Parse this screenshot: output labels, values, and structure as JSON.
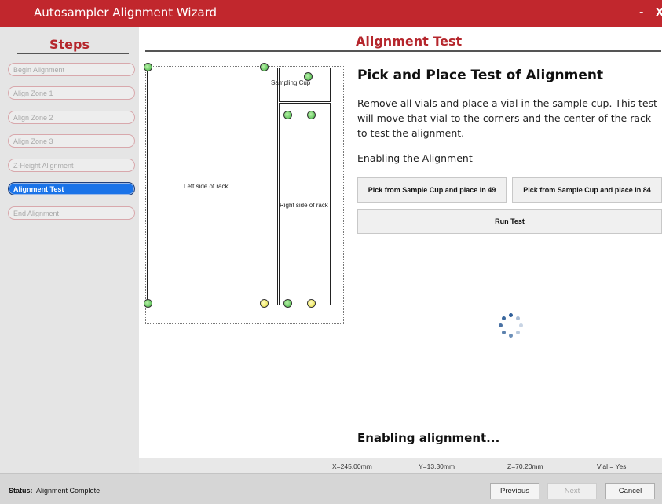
{
  "window": {
    "title": "Autosampler Alignment Wizard",
    "minimize": "-",
    "close": "X"
  },
  "sidebar": {
    "header": "Steps",
    "items": [
      {
        "label": "Begin Alignment"
      },
      {
        "label": "Align Zone 1"
      },
      {
        "label": "Align Zone 2"
      },
      {
        "label": "Align Zone 3"
      },
      {
        "label": "Z-Height Alignment"
      },
      {
        "label": "Alignment Test"
      },
      {
        "label": "End Alignment"
      }
    ],
    "active_index": 5
  },
  "main": {
    "section_title": "Alignment Test",
    "rack": {
      "sampling_cup_label": "Sampling Cup",
      "left_label": "Left side of rack",
      "right_label": "Right side of rack"
    },
    "heading": "Pick and Place Test of Alignment",
    "description": "Remove all vials and place a vial in the sample cup. This test will move that vial to the corners and the center of the rack to test the alignment.",
    "subtext": "Enabling the Alignment",
    "buttons": {
      "pick49": "Pick from Sample Cup and place in 49",
      "pick84": "Pick from Sample Cup and place in 84",
      "run_test": "Run Test"
    },
    "status_message": "Enabling alignment..."
  },
  "coords": {
    "x": "X=245.00mm",
    "y": "Y=13.30mm",
    "z": "Z=70.20mm",
    "vial": "Vial = Yes"
  },
  "statusbar": {
    "label": "Status:",
    "value": "Alignment Complete",
    "previous": "Previous",
    "next": "Next",
    "cancel": "Cancel"
  },
  "colors": {
    "brand": "#c1272d",
    "active_step": "#1a73e8",
    "dot_green": "#3fb53f",
    "dot_yellow": "#e8e23a"
  }
}
